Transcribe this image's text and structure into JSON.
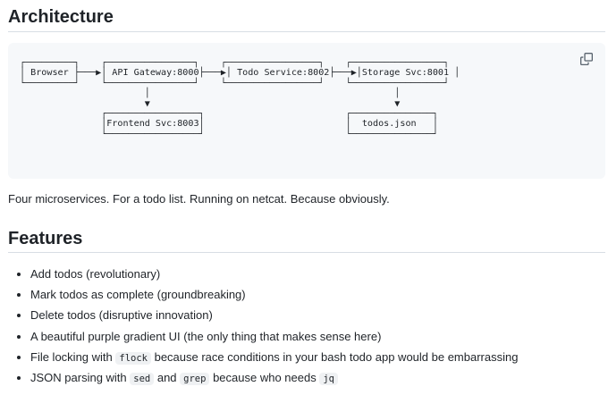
{
  "architecture": {
    "heading": "Architecture",
    "diagram": "┌─────────┐    ┌────────────────┐    ┌─────────────────┐    ┌─────────────────┐\n│ Browser ├───▶│ API Gateway:8000├───▶│ Todo Service:8002├───▶│Storage Svc:8001 │\n└─────────┘    └────────────────┘    └─────────────────┘    └─────────────────┘\n                       │                                             │\n                       ▼                                             ▼\n               ┌─────────────────┐                          ┌───────────────┐\n               │Frontend Svc:8003│                          │  todos.json   │\n               └─────────────────┘                          └───────────────┘",
    "copy_icon": "copy-icon",
    "description": "Four microservices. For a todo list. Running on netcat. Because obviously."
  },
  "features": {
    "heading": "Features",
    "items": [
      {
        "text": "Add todos (revolutionary)"
      },
      {
        "text": "Mark todos as complete (groundbreaking)"
      },
      {
        "text": "Delete todos (disruptive innovation)"
      },
      {
        "text": "A beautiful purple gradient UI (the only thing that makes sense here)"
      },
      {
        "pre": "File locking with ",
        "code1": "flock",
        "post": " because race conditions in your bash todo app would be embarrassing"
      },
      {
        "pre": "JSON parsing with ",
        "code1": "sed",
        "mid": " and ",
        "code2": "grep",
        "mid2": " because who needs ",
        "code3": "jq"
      }
    ]
  }
}
